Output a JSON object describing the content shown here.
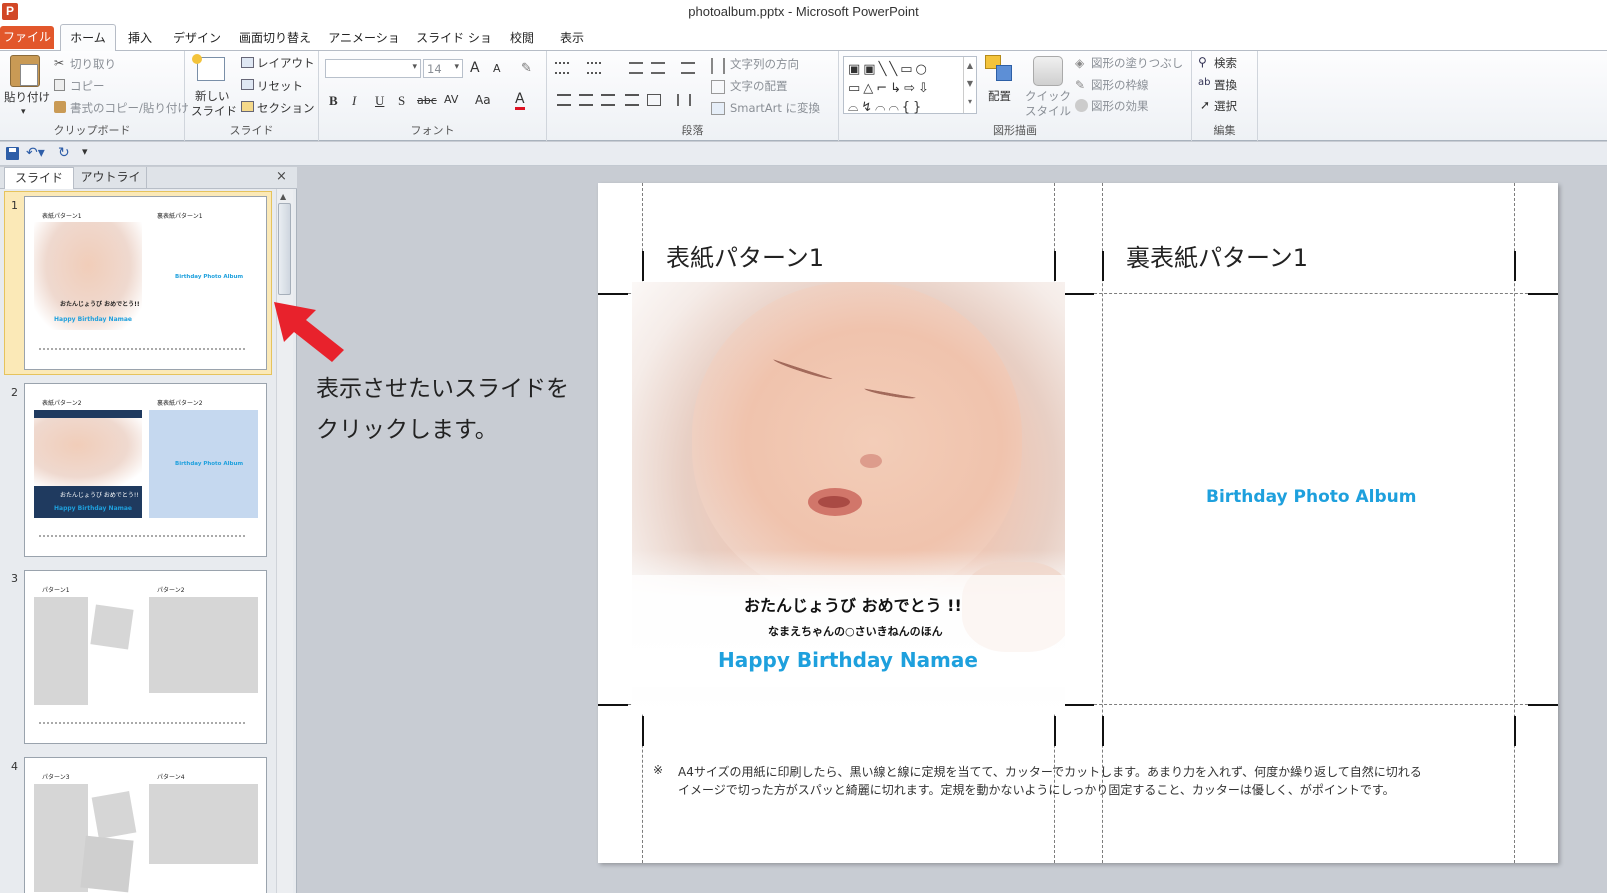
{
  "window": {
    "title": "photoalbum.pptx - Microsoft PowerPoint",
    "app_icon": "P"
  },
  "tabs": [
    "ファイル",
    "ホーム",
    "挿入",
    "デザイン",
    "画面切り替え",
    "アニメーション",
    "スライド ショー",
    "校閲",
    "表示"
  ],
  "ribbon": {
    "clipboard": {
      "paste": "貼り付け",
      "cut": "切り取り",
      "copy": "コピー",
      "format_painter": "書式のコピー/貼り付け",
      "label": "クリップボード"
    },
    "slides": {
      "new_slide": "新しい",
      "new_slide2": "スライド",
      "layout": "レイアウト",
      "reset": "リセット",
      "section": "セクション",
      "label": "スライド"
    },
    "font": {
      "size": "14",
      "label": "フォント",
      "bold": "B",
      "italic": "I",
      "underline": "U",
      "shadow": "S",
      "strike": "abc",
      "spacing": "AV",
      "case": "Aa",
      "color": "A",
      "grow": "A",
      "shrink": "A"
    },
    "paragraph": {
      "text_direction": "文字列の方向",
      "align_text": "文字の配置",
      "smartart": "SmartArt に変換",
      "label": "段落"
    },
    "drawing": {
      "arrange": "配置",
      "quick_styles": "クイック",
      "quick_styles2": "スタイル",
      "fill": "図形の塗りつぶし",
      "outline": "図形の枠線",
      "effects": "図形の効果",
      "label": "図形描画"
    },
    "editing": {
      "find": "検索",
      "replace": "置換",
      "select": "選択",
      "label": "編集"
    }
  },
  "pane": {
    "tab_slides": "スライド",
    "tab_outline": "アウトライン",
    "close": "×",
    "thumbs": [
      {
        "num": "1",
        "left_title": "表紙パターン1",
        "right_title": "裏表紙パターン1",
        "album": "Birthday Photo Album",
        "line1": "おたんじょうび おめでとう!!",
        "line2": "なまえちゃんの○さいきねんのほん",
        "hb": "Happy Birthday Namae"
      },
      {
        "num": "2",
        "left_title": "表紙パターン2",
        "right_title": "裏表紙パターン2",
        "album": "Birthday Photo Album",
        "line1": "おたんじょうび おめでとう!!",
        "hb": "Happy Birthday Namae"
      },
      {
        "num": "3",
        "left_title": "パターン1",
        "right_title": "パターン2"
      },
      {
        "num": "4",
        "left_title": "パターン3",
        "right_title": "パターン4"
      }
    ]
  },
  "annotation": {
    "line1": "表示させたいスライドを",
    "line2": "クリックします。",
    "arrow_color": "#e8222c"
  },
  "slide": {
    "cover_title": "表紙パターン1",
    "back_title": "裏表紙パターン1",
    "album_title": "Birthday Photo Album",
    "greeting": "おたんじょうび おめでとう !!",
    "subline": "なまえちゃんの○さいきねんのほん",
    "hb": "Happy Birthday Namae",
    "note_mark": "※",
    "note_line1": "A4サイズの用紙に印刷したら、黒い線と線に定規を当てて、カッターでカットします。あまり力を入れず、何度か繰り返して自然に切れる",
    "note_line2": "イメージで切った方がスパッと綺麗に切れます。定規を動かないようにしっかり固定すること、カッターは優しく、がポイントです。",
    "accent": "#1ea0dd"
  }
}
